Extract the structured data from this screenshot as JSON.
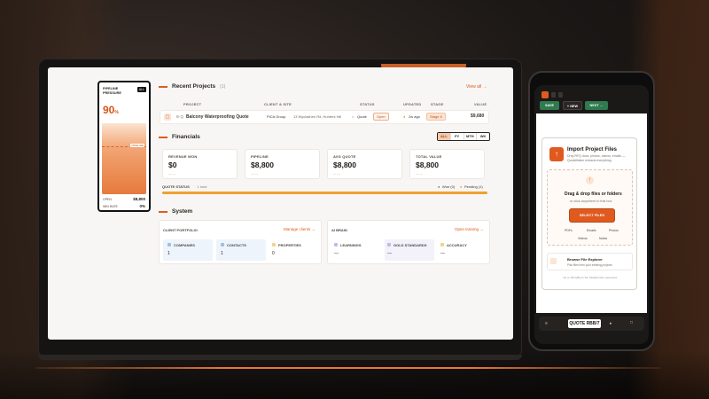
{
  "dashboard": {
    "recent_projects": {
      "title": "Recent Projects",
      "count": "(1)",
      "view_all": "View all →",
      "columns": [
        "PROJECT",
        "CLIENT & SITE",
        "STATUS",
        "UPDATED",
        "STAGE",
        "VALUE"
      ],
      "rows": [
        {
          "tag": "B·Q",
          "name": "Balcony Waterproofing Quote",
          "client": "PICA Group",
          "site": "13 Wyclashen Rd, Hunters Hill",
          "type": "Quote",
          "status": "Open",
          "updated": "2w ago",
          "stage": "Stage 6",
          "value": "$9,680"
        }
      ]
    },
    "financials": {
      "title": "Financials",
      "tabs": [
        "ALL",
        "FY",
        "MTH",
        "WK"
      ],
      "active_tab": "ALL",
      "cards": [
        {
          "label": "REVENUE WON",
          "value": "$0",
          "sub": "— —"
        },
        {
          "label": "PIPELINE",
          "value": "$8,800",
          "sub": "— —"
        },
        {
          "label": "AVG QUOTE",
          "value": "$8,800",
          "sub": "— —"
        },
        {
          "label": "TOTAL VALUE",
          "value": "$8,800",
          "sub": "— —"
        }
      ],
      "quote_status_label": "QUOTE STATUS",
      "quote_status_total": "· 1 total",
      "won": "Won (0)",
      "pending": "Pending (1)"
    },
    "system": {
      "title": "System",
      "client_portfolio": {
        "title": "CLIENT PORTFOLIO",
        "link": "Manage clients →",
        "items": [
          {
            "label": "COMPANIES",
            "value": "1",
            "color": "#cfe0f3"
          },
          {
            "label": "CONTACTS",
            "value": "1",
            "color": "#cfe0f3"
          },
          {
            "label": "PROPERTIES",
            "value": "0",
            "color": "#f6e1b3"
          }
        ]
      },
      "ai_brain": {
        "title": "AI BRAIN",
        "link": "Open training →",
        "items": [
          {
            "label": "LEARNINGS",
            "value": "—",
            "color": "#d9d3f0"
          },
          {
            "label": "GOLD STANDARDS",
            "value": "—",
            "color": "#d9d3f0"
          },
          {
            "label": "ACCURACY",
            "value": "—",
            "color": "#f6e1b3"
          }
        ]
      }
    },
    "pipeline_pressure": {
      "title_line1": "PIPELINE",
      "title_line2": "PRESSURE",
      "badge": "ALL",
      "score": "90",
      "score_unit": "%",
      "marker": "PIPELINE",
      "open_label": "OPEN",
      "open_value": "$8,800",
      "win_rate_label": "WIN RATE",
      "win_rate_value": "0%"
    }
  },
  "phone": {
    "toolbar": {
      "save": "SAVE",
      "new": "+ NEW",
      "next": "NEXT →"
    },
    "modal": {
      "title": "Import Project Files",
      "subtitle": "Drop RFQ docs, photos, videos, emails — QuoteMaker extracts everything.",
      "drop_title": "Drag & drop files or folders",
      "drop_sub": "or click anywhere in this box",
      "select_button": "SELECT FILES",
      "types": [
        "PDFs",
        "Emails",
        "Photos",
        "Videos",
        "Notes"
      ],
      "browse_title": "Browse File Explorer",
      "browse_sub": "Pick files from your existing projects",
      "footer": "Up to 100 MB per file. Multiple files supported."
    },
    "bottom": {
      "label": "QUOTE RBB/7"
    }
  },
  "colors": {
    "accent": "#e05a1f",
    "bar": "#f0a030",
    "save_green": "#2f7a4f"
  }
}
